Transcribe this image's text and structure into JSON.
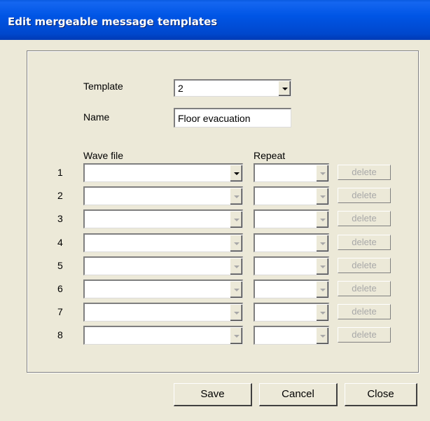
{
  "window": {
    "title": "Edit mergeable message templates"
  },
  "form": {
    "template_label": "Template",
    "template_value": "2",
    "name_label": "Name",
    "name_value": "Floor evacuation",
    "wave_header": "Wave file",
    "repeat_header": "Repeat"
  },
  "rows": [
    {
      "num": "1",
      "wave": "",
      "repeat": "",
      "delete": "delete"
    },
    {
      "num": "2",
      "wave": "",
      "repeat": "",
      "delete": "delete"
    },
    {
      "num": "3",
      "wave": "",
      "repeat": "",
      "delete": "delete"
    },
    {
      "num": "4",
      "wave": "",
      "repeat": "",
      "delete": "delete"
    },
    {
      "num": "5",
      "wave": "",
      "repeat": "",
      "delete": "delete"
    },
    {
      "num": "6",
      "wave": "",
      "repeat": "",
      "delete": "delete"
    },
    {
      "num": "7",
      "wave": "",
      "repeat": "",
      "delete": "delete"
    },
    {
      "num": "8",
      "wave": "",
      "repeat": "",
      "delete": "delete"
    }
  ],
  "buttons": {
    "save": "Save",
    "cancel": "Cancel",
    "close": "Close"
  },
  "colors": {
    "titlebar": "#0055e5",
    "background": "#ece9d8",
    "disabled_text": "#a8a8a8"
  }
}
